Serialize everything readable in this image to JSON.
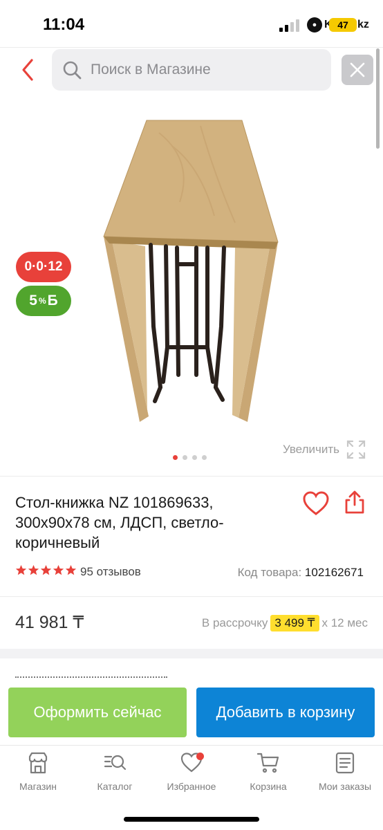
{
  "status_bar": {
    "time": "11:04",
    "site_label": "Kaspi.kz",
    "battery": "47"
  },
  "search": {
    "placeholder": "Поиск в Магазине"
  },
  "badges": {
    "installment": "0·0·12",
    "bonus_percent": "5",
    "bonus_symbol": "Б"
  },
  "gallery": {
    "zoom_label": "Увеличить",
    "slide_count": 4,
    "active_slide": 1
  },
  "product": {
    "title": "Стол-книжка NZ 101869633, 300x90x78 см, ЛДСП, светло-коричневый",
    "rating": 5,
    "reviews": "95 отзывов",
    "sku_label": "Код товара:",
    "sku_value": "102162671"
  },
  "price": {
    "value": "41 981 ₸",
    "installment_prefix": "В рассрочку",
    "installment_amount": "3 499 ₸",
    "installment_suffix": "х 12 мес"
  },
  "actions": {
    "buy_now": "Оформить сейчас",
    "add_to_cart": "Добавить в корзину"
  },
  "tabbar": {
    "items": [
      {
        "label": "Магазин",
        "icon": "store-icon"
      },
      {
        "label": "Каталог",
        "icon": "catalog-search-icon"
      },
      {
        "label": "Избранное",
        "icon": "heart-icon"
      },
      {
        "label": "Корзина",
        "icon": "cart-icon"
      },
      {
        "label": "Мои заказы",
        "icon": "orders-icon"
      }
    ]
  },
  "colors": {
    "accent_red": "#e8413a",
    "buy_green": "#93d25a",
    "cart_blue": "#0d84d6",
    "installment_yellow": "#ffde2e"
  }
}
